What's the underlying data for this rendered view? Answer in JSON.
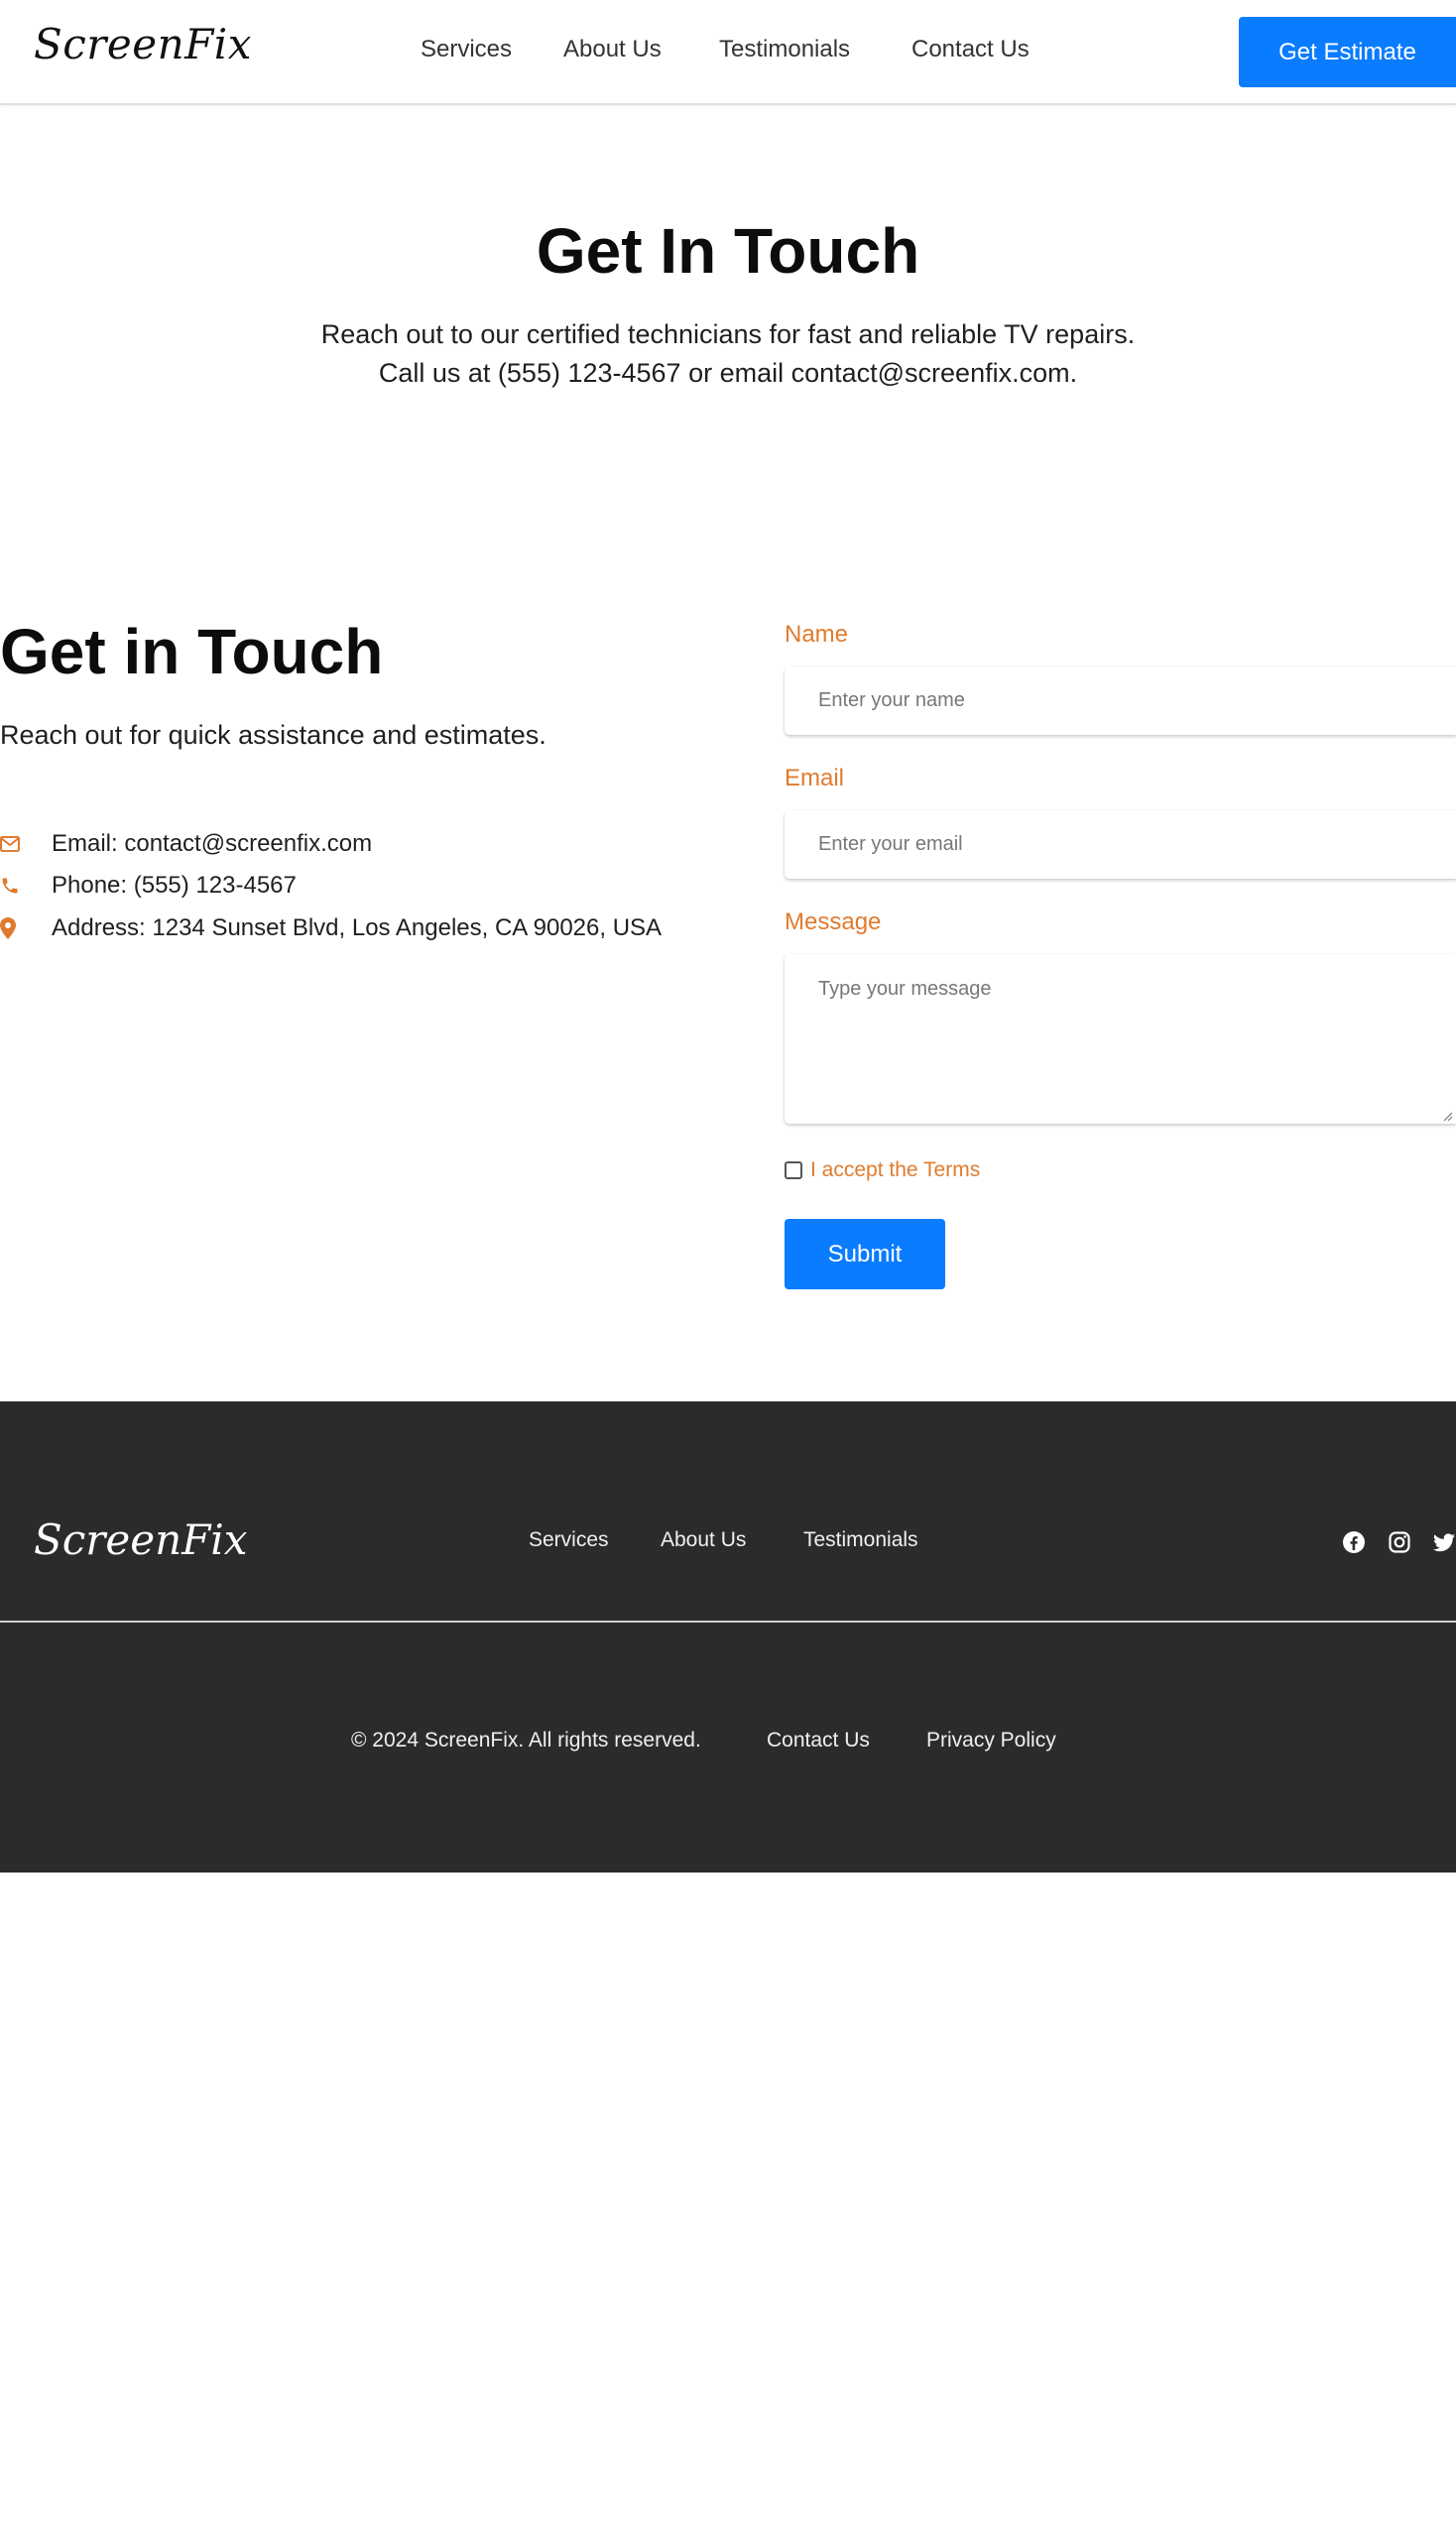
{
  "header": {
    "logo": "ScreenFix",
    "nav": [
      "Services",
      "About Us",
      "Testimonials",
      "Contact Us"
    ],
    "cta_label": "Get Estimate"
  },
  "hero": {
    "title": "Get In Touch",
    "subtitle": "Reach out to our certified technicians for fast and reliable TV repairs. Call us at (555) 123-4567 or email contact@screenfix.com."
  },
  "contact": {
    "title": "Get in Touch",
    "subtitle": "Reach out for quick assistance and estimates.",
    "email": "Email: contact@screenfix.com",
    "phone": "Phone: (555) 123-4567",
    "address": "Address: 1234 Sunset Blvd, Los Angeles, CA 90026, USA"
  },
  "form": {
    "name_label": "Name",
    "name_placeholder": "Enter your name",
    "email_label": "Email",
    "email_placeholder": "Enter your email",
    "message_label": "Message",
    "message_placeholder": "Type your message",
    "terms_label": "I accept the Terms",
    "submit_label": "Submit"
  },
  "footer": {
    "logo": "ScreenFix",
    "nav": [
      "Services",
      "About Us",
      "Testimonials"
    ],
    "social_icons": [
      "facebook-icon",
      "instagram-icon",
      "twitter-icon"
    ],
    "copyright": "© 2024 ScreenFix. All rights reserved.",
    "contact_link": "Contact Us",
    "privacy_link": "Privacy Policy"
  },
  "colors": {
    "accent": "#e07b2e",
    "primary_button": "#0a7cff",
    "footer_bg": "#2b2b2b"
  }
}
